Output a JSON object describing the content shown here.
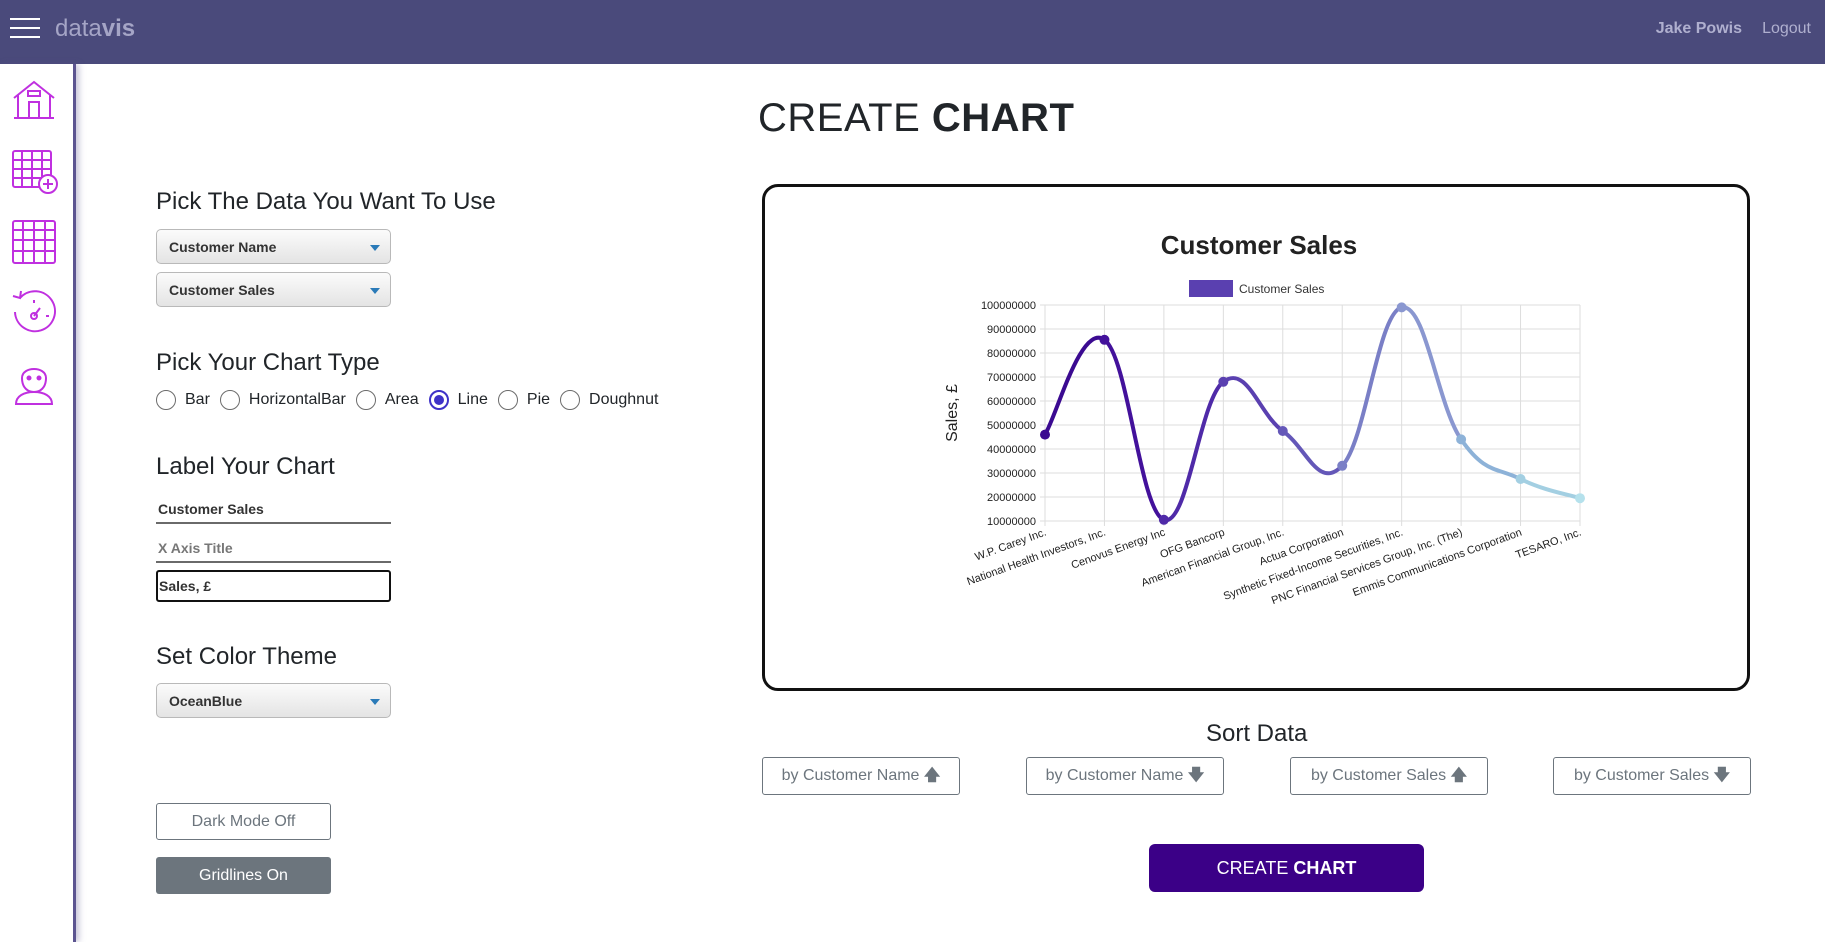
{
  "app": {
    "brand_light": "data",
    "brand_bold": "vis",
    "user": "Jake Powis",
    "logout": "Logout"
  },
  "sidebar": {
    "items": [
      {
        "name": "home-icon"
      },
      {
        "name": "add-table-icon"
      },
      {
        "name": "table-icon"
      },
      {
        "name": "history-icon"
      },
      {
        "name": "profile-icon"
      }
    ],
    "icon_color": "#c030e0"
  },
  "page": {
    "title_light": "CREATE ",
    "title_bold": "CHART"
  },
  "data_section": {
    "title": "Pick The Data You Want To Use",
    "x_select": "Customer Name",
    "y_select": "Customer Sales"
  },
  "chart_type_section": {
    "title": "Pick Your Chart Type",
    "options": [
      "Bar",
      "HorizontalBar",
      "Area",
      "Line",
      "Pie",
      "Doughnut"
    ],
    "selected": "Line"
  },
  "label_section": {
    "title": "Label Your Chart",
    "chart_title_value": "Customer Sales",
    "x_title_placeholder": "X Axis Title",
    "y_title_value": "Sales, £"
  },
  "theme_section": {
    "title": "Set Color Theme",
    "theme": "OceanBlue"
  },
  "toggles": {
    "dark_mode": "Dark Mode Off",
    "gridlines": "Gridlines On"
  },
  "sort": {
    "title": "Sort Data",
    "buttons": [
      {
        "label": "by Customer Name",
        "arrow": "🡅"
      },
      {
        "label": "by Customer Name",
        "arrow": "🡇"
      },
      {
        "label": "by Customer Sales",
        "arrow": "🡅"
      },
      {
        "label": "by Customer Sales",
        "arrow": "🡇"
      }
    ]
  },
  "create_button": {
    "light": "CREATE ",
    "bold": "CHART"
  },
  "chart_data": {
    "type": "line",
    "title": "Customer Sales",
    "legend": "Customer Sales",
    "legend_position": "top",
    "ylabel": "Sales, £",
    "xlabel": "",
    "grid": true,
    "ylim": [
      10000000,
      100000000
    ],
    "yticks": [
      10000000,
      20000000,
      30000000,
      40000000,
      50000000,
      60000000,
      70000000,
      80000000,
      90000000,
      100000000
    ],
    "categories": [
      "W.P. Carey Inc.",
      "National Health Investors, Inc.",
      "Cenovus Energy Inc",
      "OFG Bancorp",
      "American Financial Group, Inc.",
      "Actua Corporation",
      "Synthetic Fixed-Income Securities, Inc.",
      "PNC Financial Services Group, Inc. (The)",
      "Emmis Communications Corporation",
      "TESARO, Inc."
    ],
    "values": [
      46000000,
      85500000,
      10500000,
      68000000,
      47500000,
      33000000,
      99000000,
      44000000,
      27500000,
      19500000
    ],
    "colors": [
      "#3b0a91",
      "#43119b",
      "#4f2aa8",
      "#5a40b0",
      "#6457b8",
      "#7a7fc6",
      "#8a97d0",
      "#8db2d8",
      "#a3cfe2",
      "#b5e1ec"
    ]
  }
}
